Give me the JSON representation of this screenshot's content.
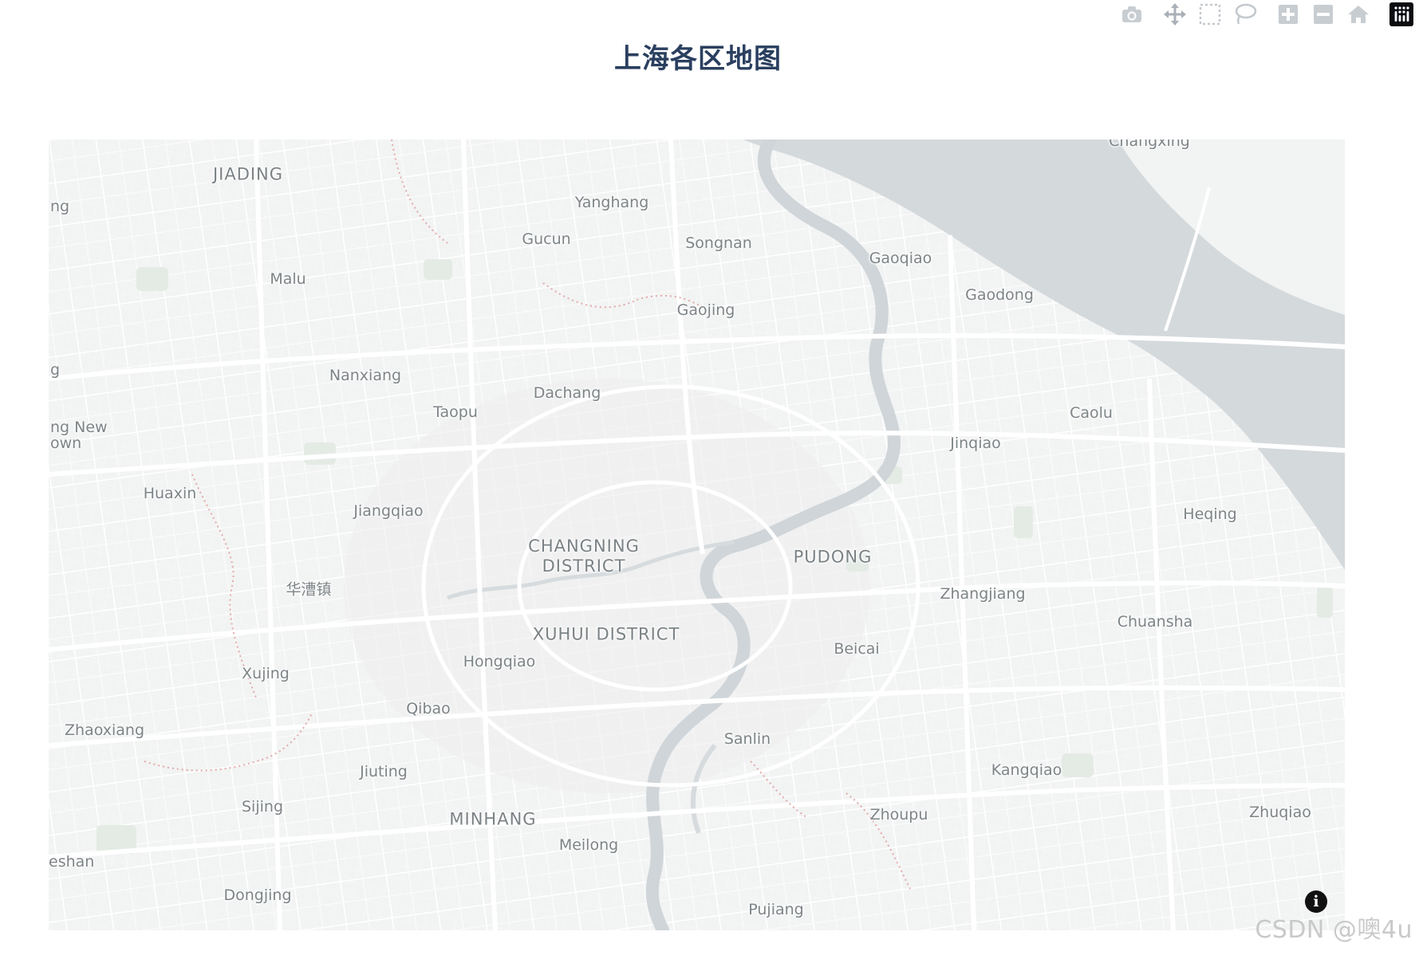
{
  "title": "上海各区地图",
  "modebar": {
    "buttons": [
      {
        "name": "camera-icon"
      },
      {
        "name": "pan-icon"
      },
      {
        "name": "box-select-icon"
      },
      {
        "name": "lasso-select-icon"
      },
      {
        "name": "zoom-in-icon"
      },
      {
        "name": "zoom-out-icon"
      },
      {
        "name": "reset-view-icon"
      },
      {
        "name": "plotly-logo-icon"
      }
    ]
  },
  "map": {
    "water_color": "#d4d9dc",
    "land_color": "#f2f3f3",
    "road_color": "#ffffff",
    "labels": {
      "jiading": "JIADING",
      "yanghang": "Yanghang",
      "gucun": "Gucun",
      "songnan": "Songnan",
      "gaoqiao": "Gaoqiao",
      "gaodong": "Gaodong",
      "changxing": "Changxing",
      "malu": "Malu",
      "gaojing": "Gaojing",
      "nanxiang": "Nanxiang",
      "dachang": "Dachang",
      "taopu": "Taopu",
      "caolu": "Caolu",
      "jinqiao": "Jinqiao",
      "ng_new": "ng New",
      "own": "own",
      "ng": "ng",
      "g": "g",
      "huaxin": "Huaxin",
      "jiangqiao": "Jiangqiao",
      "changning_1": "CHANGNING",
      "changning_2": "DISTRICT",
      "pudong": "PUDONG",
      "heqing": "Heqing",
      "huacaozhen": "华漕镇",
      "zhangjiang": "Zhangjiang",
      "xuhui": "XUHUI DISTRICT",
      "chuansha": "Chuansha",
      "hongqiao": "Hongqiao",
      "beicai": "Beicai",
      "xujing": "Xujing",
      "qibao": "Qibao",
      "zhaoxiang": "Zhaoxiang",
      "sanlin": "Sanlin",
      "jiuting": "Jiuting",
      "kangqiao": "Kangqiao",
      "sijing": "Sijing",
      "minhang": "MINHANG",
      "zhoupu": "Zhoupu",
      "zhuqiao": "Zhuqiao",
      "meilong": "Meilong",
      "eshan": "eshan",
      "dongjing": "Dongjing",
      "pujiang": "Pujiang"
    }
  },
  "info_button": {
    "glyph": "i"
  },
  "watermark": "CSDN @噢4u"
}
